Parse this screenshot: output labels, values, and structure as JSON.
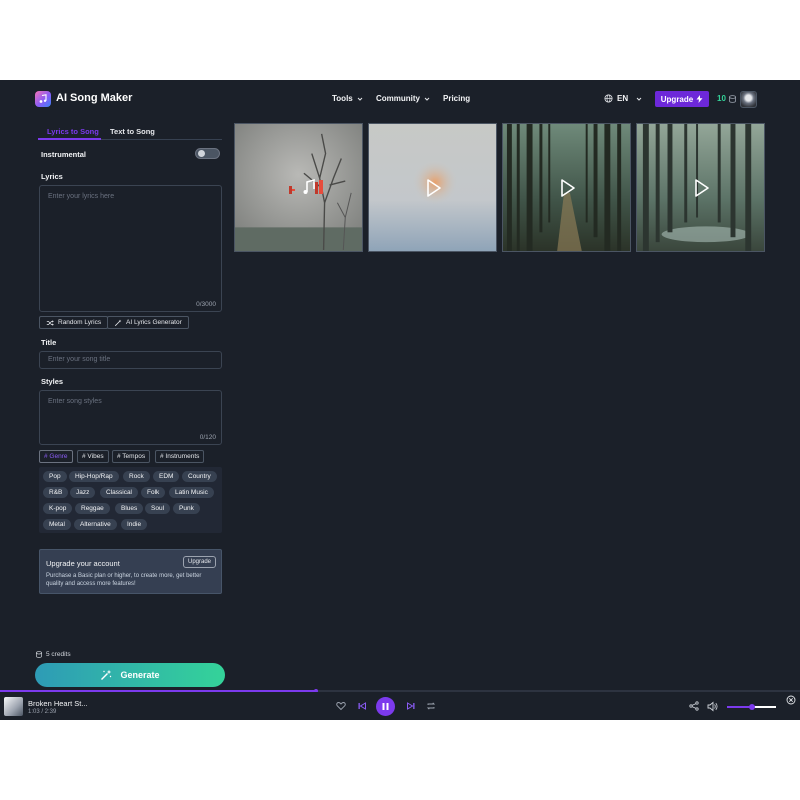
{
  "header": {
    "brand": "AI Song Maker",
    "nav": [
      "Tools",
      "Community",
      "Pricing"
    ],
    "language": "EN",
    "upgrade_label": "Upgrade",
    "credits": "10"
  },
  "create": {
    "tabs": [
      "Lyrics to Song",
      "Text to Song"
    ],
    "active_tab": "Lyrics to Song",
    "instrumental_label": "Instrumental",
    "instrumental_on": false,
    "lyrics_label": "Lyrics",
    "lyrics_placeholder": "Enter your lyrics here",
    "lyrics_counter": "0/3000",
    "random_lyrics_label": "Random Lyrics",
    "ai_lyrics_label": "AI Lyrics Generator",
    "title_label": "Title",
    "title_placeholder": "Enter your song title",
    "styles_label": "Styles",
    "styles_placeholder": "Enter song styles",
    "styles_counter": "0/120",
    "style_tabs": [
      "# Genre",
      "# Vibes",
      "# Tempos",
      "# Instruments"
    ],
    "genres": [
      "Pop",
      "Hip-Hop/Rap",
      "Rock",
      "EDM",
      "Country",
      "R&B",
      "Jazz",
      "Classical",
      "Folk",
      "Latin Music",
      "K-pop",
      "Reggae",
      "Blues",
      "Soul",
      "Punk",
      "Metal",
      "Alternative",
      "Indie"
    ]
  },
  "upsell": {
    "title": "Upgrade your account",
    "button": "Upgrade",
    "text": "Purchase a Basic plan or higher, to create more, get better quality and access more features!"
  },
  "generate": {
    "credits_note": "5 credits",
    "button": "Generate"
  },
  "thumbnails": [
    {
      "name": "bare-tree-thumbnail",
      "state": "playing"
    },
    {
      "name": "foggy-glow-thumbnail",
      "state": "play"
    },
    {
      "name": "forest-path-thumbnail",
      "state": "play"
    },
    {
      "name": "forest-pond-thumbnail",
      "state": "play"
    }
  ],
  "player": {
    "title": "Broken Heart St...",
    "time": "1:03 / 2:39",
    "progress": 0.395,
    "volume": 0.5
  },
  "colors": {
    "accent": "#7c3aed",
    "background": "#1b2029",
    "credits_green": "#34d399"
  }
}
